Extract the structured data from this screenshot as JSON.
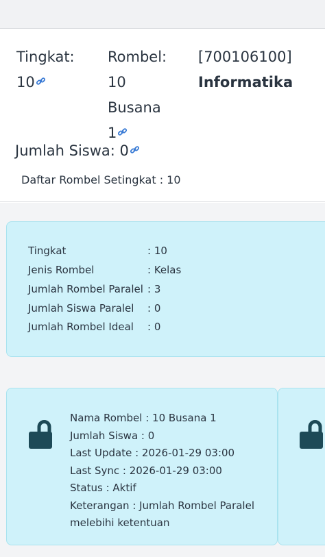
{
  "header": {
    "tingkat_label": "Tingkat:",
    "tingkat_value": "10",
    "rombel_label": "Rombel:",
    "rombel_line1": "10",
    "rombel_line2": "Busana",
    "rombel_line3": "1",
    "kode": "[700106100]",
    "jurusan": "Informatika",
    "jumlah_siswa": "Jumlah Siswa: 0",
    "daftar": "Daftar Rombel Setingkat : 10"
  },
  "info": {
    "rows": [
      {
        "label": "Tingkat",
        "value": ": 10"
      },
      {
        "label": "Jenis Rombel",
        "value": ": Kelas"
      },
      {
        "label": "Jumlah Rombel Paralel",
        "value": ": 3"
      },
      {
        "label": "Jumlah Siswa Paralel",
        "value": ": 0"
      },
      {
        "label": "Jumlah Rombel Ideal",
        "value": ": 0"
      }
    ]
  },
  "cards": [
    {
      "lines": [
        "Nama Rombel : 10 Busana 1",
        "Jumlah Siswa : 0",
        "Last Update : 2026-01-29 03:00",
        "Last Sync : 2026-01-29 03:00",
        "Status : Aktif",
        "Keterangan : Jumlah Rombel Paralel",
        "melebihi ketentuan"
      ]
    }
  ],
  "colors": {
    "card_bg": "#cff2fa",
    "card_border": "#a9e3ef",
    "icon": "#1d4a57",
    "link": "#3a7bd5"
  },
  "icons": {
    "link": "link-icon",
    "lock": "unlock-icon"
  }
}
